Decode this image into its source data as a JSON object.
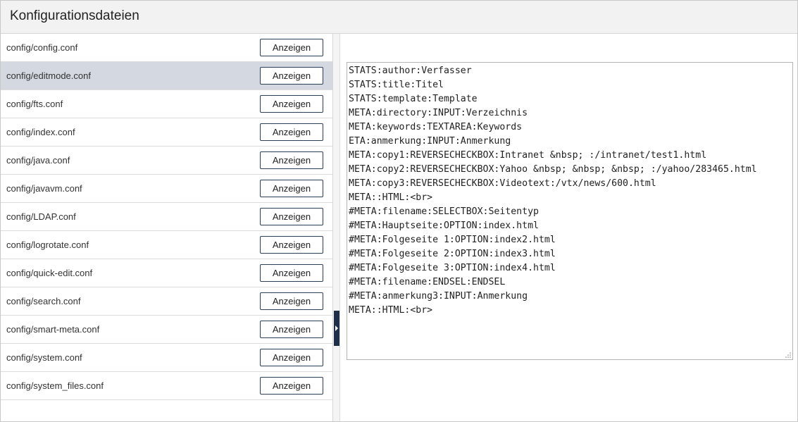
{
  "window": {
    "title": "Konfigurationsdateien"
  },
  "files": [
    {
      "name": "config/config.conf",
      "button": "Anzeigen",
      "selected": false
    },
    {
      "name": "config/editmode.conf",
      "button": "Anzeigen",
      "selected": true
    },
    {
      "name": "config/fts.conf",
      "button": "Anzeigen",
      "selected": false
    },
    {
      "name": "config/index.conf",
      "button": "Anzeigen",
      "selected": false
    },
    {
      "name": "config/java.conf",
      "button": "Anzeigen",
      "selected": false
    },
    {
      "name": "config/javavm.conf",
      "button": "Anzeigen",
      "selected": false
    },
    {
      "name": "config/LDAP.conf",
      "button": "Anzeigen",
      "selected": false
    },
    {
      "name": "config/logrotate.conf",
      "button": "Anzeigen",
      "selected": false
    },
    {
      "name": "config/quick-edit.conf",
      "button": "Anzeigen",
      "selected": false
    },
    {
      "name": "config/search.conf",
      "button": "Anzeigen",
      "selected": false
    },
    {
      "name": "config/smart-meta.conf",
      "button": "Anzeigen",
      "selected": false
    },
    {
      "name": "config/system.conf",
      "button": "Anzeigen",
      "selected": false
    },
    {
      "name": "config/system_files.conf",
      "button": "Anzeigen",
      "selected": false
    }
  ],
  "editor": {
    "lines": [
      "STATS:author:Verfasser",
      "STATS:title:Titel",
      "STATS:template:Template",
      "META:directory:INPUT:Verzeichnis",
      "META:keywords:TEXTAREA:Keywords",
      "ETA:anmerkung:INPUT:Anmerkung",
      "META:copy1:REVERSECHECKBOX:Intranet &nbsp; :/intranet/test1.html",
      "META:copy2:REVERSECHECKBOX:Yahoo &nbsp; &nbsp; &nbsp; :/yahoo/283465.html",
      "META:copy3:REVERSECHECKBOX:Videotext:/vtx/news/600.html",
      "META::HTML:<br>",
      "#META:filename:SELECTBOX:Seitentyp",
      "#META:Hauptseite:OPTION:index.html",
      "#META:Folgeseite 1:OPTION:index2.html",
      "#META:Folgeseite 2:OPTION:index3.html",
      "#META:Folgeseite 3:OPTION:index4.html",
      "#META:filename:ENDSEL:ENDSEL",
      "#META:anmerkung3:INPUT:Anmerkung",
      "META::HTML:<br>"
    ]
  },
  "colors": {
    "selected_row": "#d4d8e0",
    "accent": "#1f2f4a",
    "titlebar_bg": "#f2f2f2"
  },
  "icons": {
    "splitter": "chevron-right-icon",
    "grip": "resize-grip-icon"
  }
}
